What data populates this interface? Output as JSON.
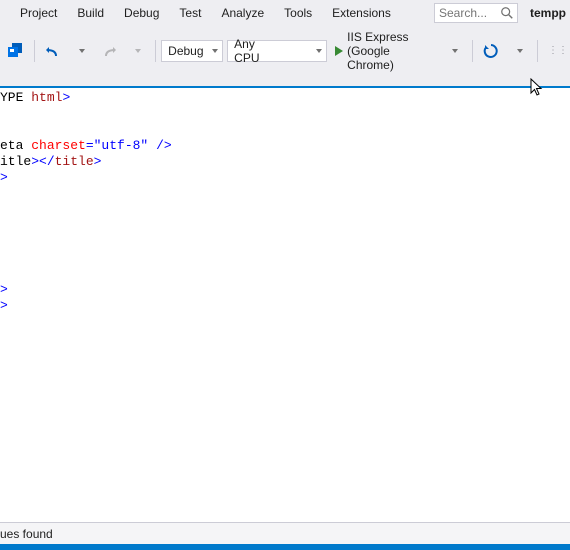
{
  "menu": {
    "items": [
      "Project",
      "Build",
      "Debug",
      "Test",
      "Analyze",
      "Tools",
      "Extensions"
    ]
  },
  "search": {
    "placeholder": "Search..."
  },
  "user": "tempp",
  "toolbar": {
    "config_selected": "Debug",
    "platform_selected": "Any CPU",
    "run_label": "IIS Express (Google Chrome)"
  },
  "editor": {
    "lines": [
      {
        "segments": [
          {
            "t": "YPE ",
            "c": "black"
          },
          {
            "t": "html",
            "c": "maroon"
          },
          {
            "t": ">",
            "c": "blue"
          }
        ]
      },
      {
        "segments": []
      },
      {
        "segments": []
      },
      {
        "segments": [
          {
            "t": "eta ",
            "c": "black"
          },
          {
            "t": "charset",
            "c": "red"
          },
          {
            "t": "=\"utf-8\"",
            "c": "blue"
          },
          {
            "t": " ",
            "c": "black"
          },
          {
            "t": "/>",
            "c": "blue"
          }
        ]
      },
      {
        "segments": [
          {
            "t": "itle",
            "c": "black"
          },
          {
            "t": "></",
            "c": "blue"
          },
          {
            "t": "title",
            "c": "maroon"
          },
          {
            "t": ">",
            "c": "blue"
          }
        ]
      },
      {
        "segments": [
          {
            "t": ">",
            "c": "blue"
          }
        ]
      },
      {
        "segments": []
      },
      {
        "segments": []
      },
      {
        "segments": []
      },
      {
        "segments": []
      },
      {
        "segments": []
      },
      {
        "segments": []
      },
      {
        "segments": [
          {
            "t": ">",
            "c": "blue"
          }
        ]
      },
      {
        "segments": [
          {
            "t": ">",
            "c": "blue"
          }
        ]
      }
    ]
  },
  "issues": {
    "text": "ues found"
  },
  "colors": {
    "accent": "#007acc",
    "run_green": "#388a34"
  }
}
